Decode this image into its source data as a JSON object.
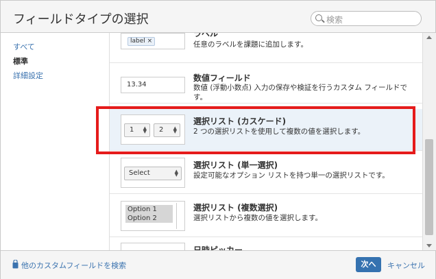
{
  "dialog": {
    "title": "フィールドタイプの選択"
  },
  "search": {
    "placeholder": "検索"
  },
  "sidebar": {
    "items": [
      {
        "label": "すべて",
        "active": false
      },
      {
        "label": "標準",
        "active": true
      },
      {
        "label": "詳細設定",
        "active": false
      }
    ]
  },
  "fields": [
    {
      "title": "ラベル",
      "description": "任意のラベルを課題に追加します。",
      "preview": {
        "type": "label",
        "text": "label",
        "close": "×"
      }
    },
    {
      "title": "数値フィールド",
      "description": "数値 (浮動小数点) 入力の保存や検証を行うカスタム フィールドです。",
      "preview": {
        "type": "number",
        "value": "13.34"
      }
    },
    {
      "title": "選択リスト (カスケード)",
      "description": "2 つの選択リストを使用して複数の値を選択します。",
      "selected": true,
      "preview": {
        "type": "cascade",
        "values": [
          "1",
          "2"
        ]
      }
    },
    {
      "title": "選択リスト (単一選択)",
      "description": "設定可能なオプション リストを持つ単一の選択リストです。",
      "preview": {
        "type": "single",
        "value": "Select"
      }
    },
    {
      "title": "選択リスト (複数選択)",
      "description": "選択リストから複数の値を選択します。",
      "preview": {
        "type": "multi",
        "options": [
          "Option 1",
          "Option 2"
        ]
      }
    },
    {
      "title": "日時ピッカー",
      "description": "",
      "preview": {
        "type": "date"
      }
    }
  ],
  "footer": {
    "find_more": "他のカスタムフィールドを検索",
    "next": "次へ",
    "cancel": "キャンセル"
  },
  "colors": {
    "accent": "#3572b0",
    "highlight": "#e51b1b",
    "selected_row": "#ebf2f9"
  }
}
